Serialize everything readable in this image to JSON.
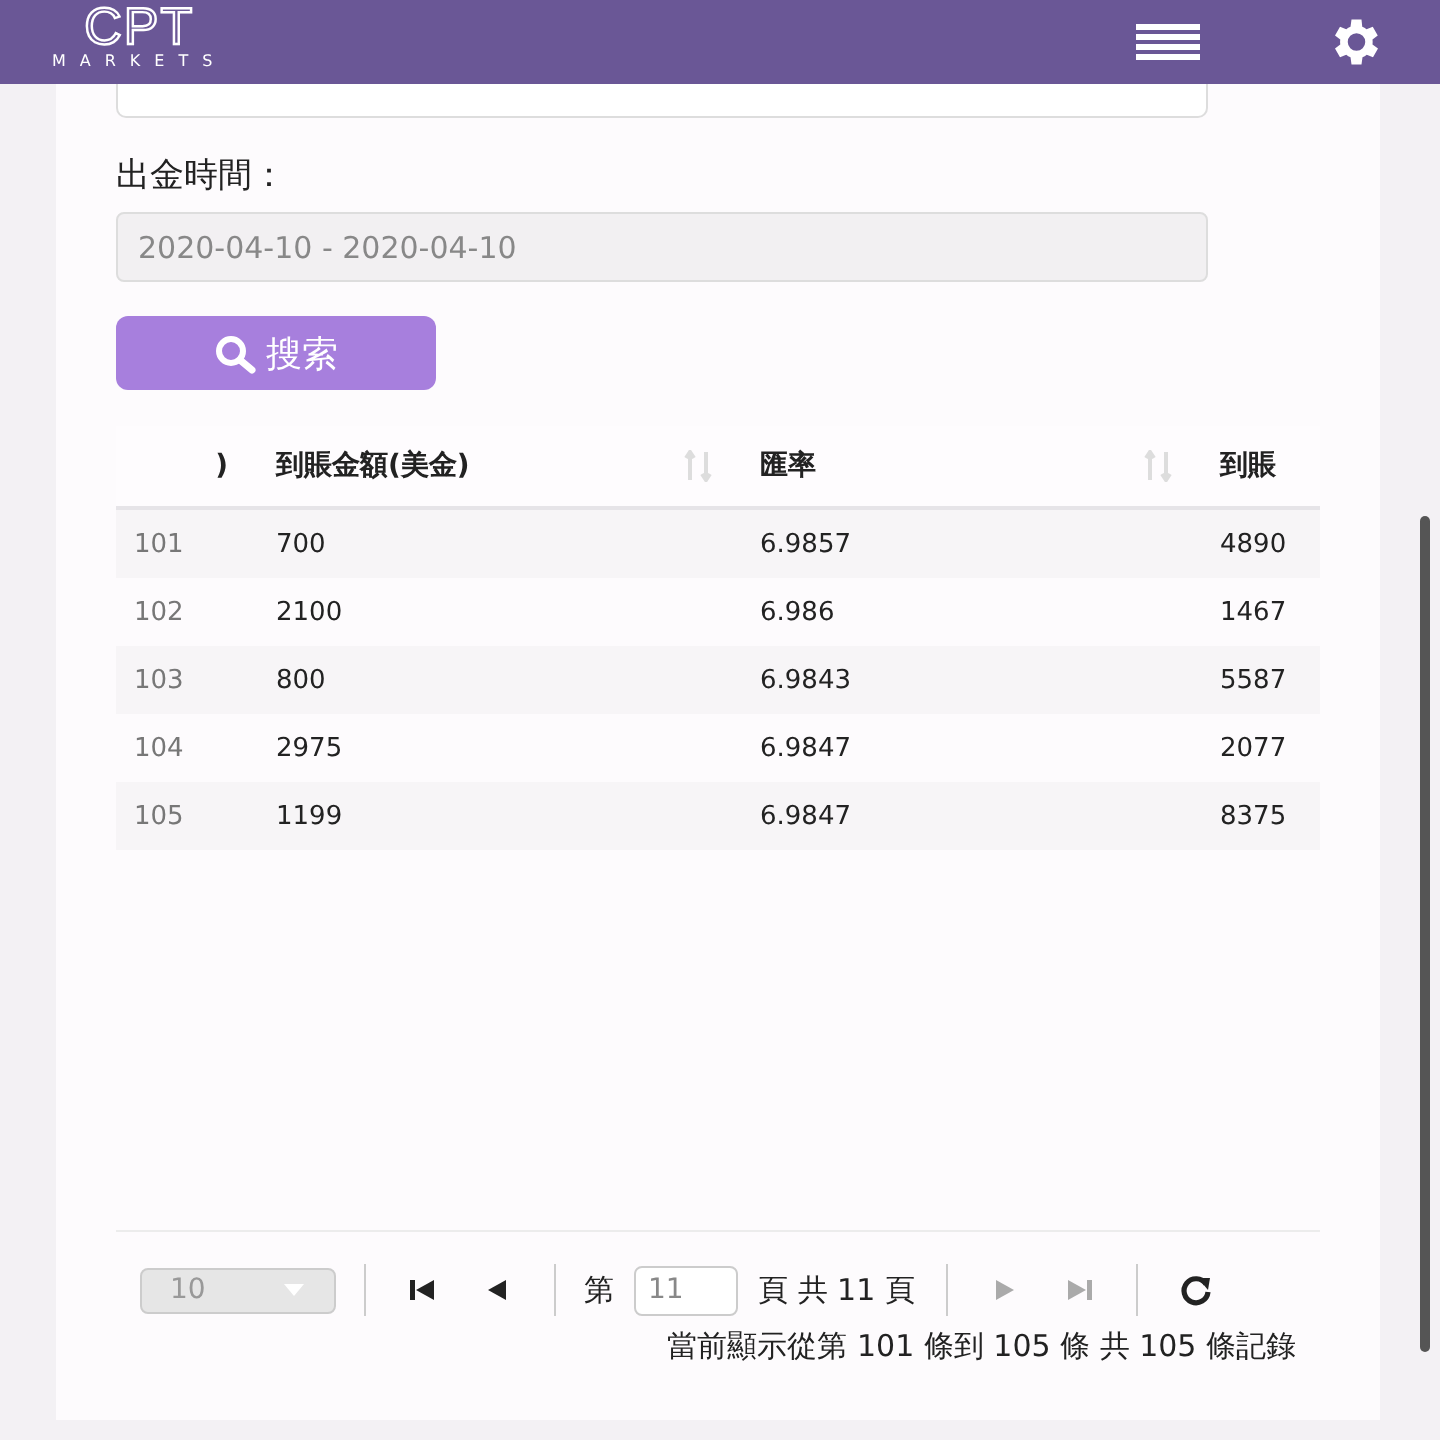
{
  "header": {
    "logo": "CPT",
    "logo_sub": "MARKETS"
  },
  "filter": {
    "label": "出金時間：",
    "value": "2020-04-10 - 2020-04-10"
  },
  "search_button": "搜索",
  "table": {
    "columns": [
      {
        "label": ")",
        "sortable": false
      },
      {
        "label": "到賬金額(美金)",
        "sortable": true
      },
      {
        "label": "匯率",
        "sortable": true
      },
      {
        "label": "到賬",
        "sortable": false
      }
    ],
    "rows": [
      [
        "101",
        "700",
        "6.9857",
        "4890"
      ],
      [
        "102",
        "2100",
        "6.986",
        "1467"
      ],
      [
        "103",
        "800",
        "6.9843",
        "5587"
      ],
      [
        "104",
        "2975",
        "6.9847",
        "2077"
      ],
      [
        "105",
        "1199",
        "6.9847",
        "8375"
      ]
    ]
  },
  "pager": {
    "page_size": "10",
    "page_label": "第",
    "page": "11",
    "of_label": "頁 共 11 頁",
    "nav": [
      {
        "kind": "first",
        "disabled": false
      },
      {
        "kind": "prev",
        "disabled": false
      },
      {
        "kind": "next",
        "disabled": true
      },
      {
        "kind": "last",
        "disabled": true
      }
    ],
    "summary": "當前顯示從第 101 條到 105 條 共 105 條記錄"
  }
}
